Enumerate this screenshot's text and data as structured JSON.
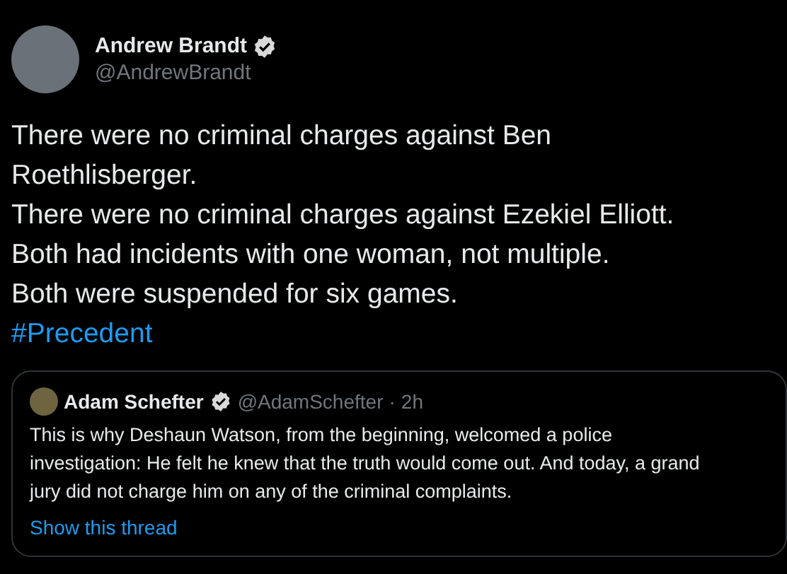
{
  "author": {
    "name": "Andrew Brandt",
    "handle": "@AndrewBrandt",
    "verified": true
  },
  "text_lines": [
    "There were no criminal charges against Ben",
    "Roethlisberger.",
    "There were no criminal charges against Ezekiel Elliott.",
    "Both had incidents with one woman, not multiple.",
    "Both were suspended for six games."
  ],
  "hashtag": "#Precedent",
  "quoted_tweet": {
    "name": "Adam Schefter",
    "verified": true,
    "handle": "@AdamSchefter",
    "separator": "·",
    "time": "2h",
    "text_lines": [
      "This is why Deshaun Watson, from the beginning, welcomed a police",
      "investigation: He felt he knew that the truth would come out. And today, a grand",
      "jury did not charge him on any of the criminal complaints."
    ],
    "link": "Show this thread"
  }
}
